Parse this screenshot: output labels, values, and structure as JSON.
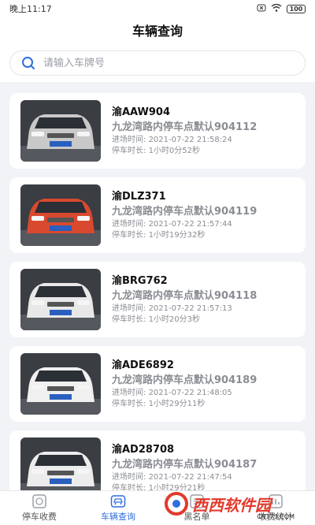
{
  "status_bar": {
    "time": "晚上11:17",
    "battery": "100"
  },
  "header": {
    "title": "车辆查询"
  },
  "search": {
    "placeholder": "请输入车牌号"
  },
  "labels": {
    "entry": "进场时间:",
    "duration": "停车时长:"
  },
  "records": [
    {
      "plate": "渝AAW904",
      "lot": "九龙湾路内停车点默认904112",
      "entry_time": "2021-07-22 21:58:24",
      "duration": "1小时0分52秒",
      "car_color": "#c9c9c9"
    },
    {
      "plate": "渝DLZ371",
      "lot": "九龙湾路内停车点默认904119",
      "entry_time": "2021-07-22 21:57:44",
      "duration": "1小时19分32秒",
      "car_color": "#d9492f"
    },
    {
      "plate": "渝BRG762",
      "lot": "九龙湾路内停车点默认904118",
      "entry_time": "2021-07-22 21:57:13",
      "duration": "1小时20分3秒",
      "car_color": "#e8e8e8"
    },
    {
      "plate": "渝ADE6892",
      "lot": "九龙湾路内停车点默认904189",
      "entry_time": "2021-07-22 21:48:05",
      "duration": "1小时29分11秒",
      "car_color": "#f0f0f0"
    },
    {
      "plate": "渝AD28708",
      "lot": "九龙湾路内停车点默认904187",
      "entry_time": "2021-07-22 21:47:54",
      "duration": "1小时29分21秒",
      "car_color": "#ececec"
    }
  ],
  "tabs": [
    {
      "label": "停车收费",
      "icon": "parking-fee-icon"
    },
    {
      "label": "车辆查询",
      "icon": "car-icon",
      "active": true
    },
    {
      "label": "黑名单",
      "icon": "blacklist-icon"
    },
    {
      "label": "收费统计",
      "icon": "stats-icon"
    }
  ],
  "watermark": {
    "text": "西西软件园",
    "sub": "CR173.COM"
  },
  "colors": {
    "accent": "#2f6fdd",
    "background": "#f2f3f7"
  }
}
